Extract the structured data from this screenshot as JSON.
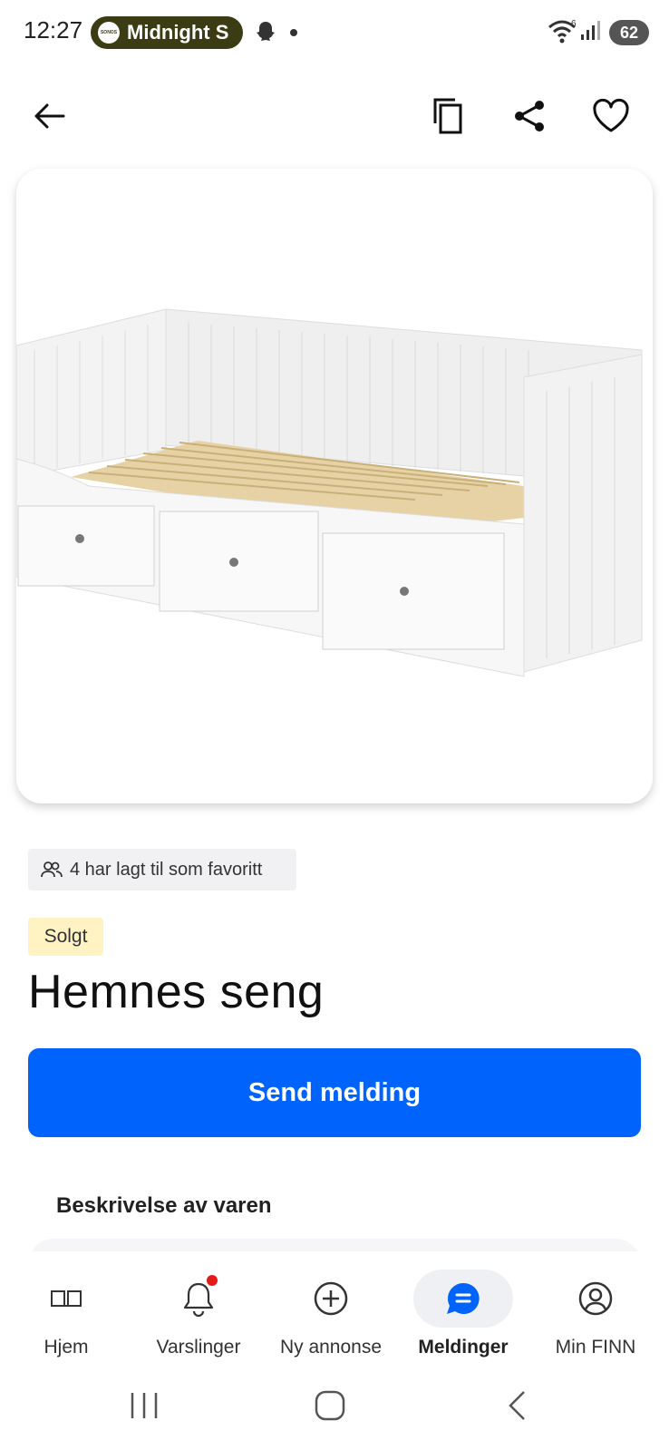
{
  "status_bar": {
    "time": "12:27",
    "media_app_logo": "SONOS",
    "media_title": "Midnight S",
    "battery": "62",
    "wifi_label": "6"
  },
  "top_nav": {
    "back_icon": "arrow-left-icon",
    "copy_icon": "copy-icon",
    "share_icon": "share-icon",
    "favorite_icon": "heart-icon"
  },
  "listing": {
    "favorites_text": "4 har lagt til som favoritt",
    "status_badge": "Solgt",
    "title": "Hemnes seng",
    "send_button": "Send melding",
    "description_heading": "Beskrivelse av varen"
  },
  "bottom_nav": {
    "items": [
      {
        "label": "Hjem",
        "icon": "book-icon",
        "active": false
      },
      {
        "label": "Varslinger",
        "icon": "bell-icon",
        "active": false,
        "badge": true
      },
      {
        "label": "Ny annonse",
        "icon": "plus-circle-icon",
        "active": false
      },
      {
        "label": "Meldinger",
        "icon": "chat-icon",
        "active": true
      },
      {
        "label": "Min FINN",
        "icon": "user-circle-icon",
        "active": false
      }
    ]
  },
  "colors": {
    "primary": "#0063fb",
    "sold_badge_bg": "#fff3c4",
    "chip_bg": "#f1f1f4",
    "notification_dot": "#e21a1a"
  }
}
